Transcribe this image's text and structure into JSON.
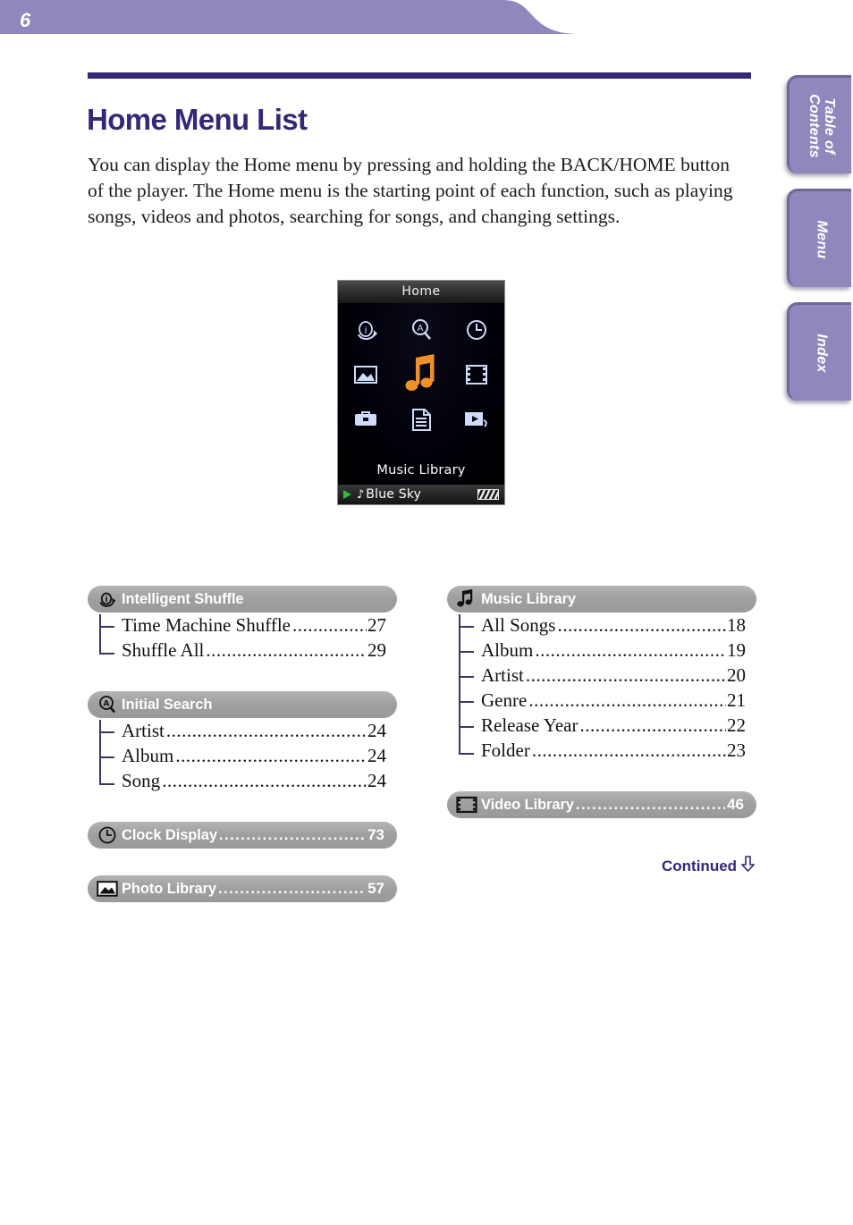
{
  "page": {
    "number": "6",
    "title": "Home Menu List",
    "intro": "You can display the Home menu by pressing and holding the BACK/HOME button of the player. The Home menu is the starting point of each function, such as playing songs, videos and photos, searching for songs, and changing settings.",
    "continued_label": "Continued",
    "continued_icon": "down-arrow-icon"
  },
  "side_tabs": [
    {
      "label": "Table of\nContents",
      "name": "table-of-contents"
    },
    {
      "label": "Menu",
      "name": "menu"
    },
    {
      "label": "Index",
      "name": "index"
    }
  ],
  "device": {
    "title": "Home",
    "caption": "Music Library",
    "status": {
      "play_icon": "play-icon",
      "note_icon": "music-note-icon",
      "track": "Blue Sky",
      "battery_icon": "battery-icon"
    },
    "icons": [
      "intelligent-shuffle-icon",
      "initial-search-icon",
      "clock-display-icon",
      "photo-library-icon",
      "music-library-icon",
      "video-library-icon",
      "settings-icon",
      "playlists-icon",
      "now-playing-icon"
    ]
  },
  "columns": {
    "left": [
      {
        "icon": "intelligent-shuffle-icon",
        "label": "Intelligent Shuffle",
        "page": "",
        "children": [
          {
            "label": "Time Machine Shuffle",
            "page": "27"
          },
          {
            "label": "Shuffle All",
            "page": "29"
          }
        ]
      },
      {
        "icon": "initial-search-icon",
        "label": "Initial Search",
        "page": "",
        "children": [
          {
            "label": "Artist",
            "page": "24"
          },
          {
            "label": "Album",
            "page": "24"
          },
          {
            "label": "Song",
            "page": "24"
          }
        ]
      },
      {
        "icon": "clock-display-icon",
        "label": "Clock Display",
        "page": "73",
        "children": []
      },
      {
        "icon": "photo-library-icon",
        "label": "Photo Library",
        "page": "57",
        "children": []
      }
    ],
    "right": [
      {
        "icon": "music-library-icon",
        "label": "Music Library",
        "page": "",
        "children": [
          {
            "label": "All Songs",
            "page": "18"
          },
          {
            "label": "Album",
            "page": "19"
          },
          {
            "label": "Artist",
            "page": "20"
          },
          {
            "label": "Genre",
            "page": "21"
          },
          {
            "label": "Release Year",
            "page": "22"
          },
          {
            "label": "Folder",
            "page": "23"
          }
        ]
      },
      {
        "icon": "video-library-icon",
        "label": "Video Library",
        "page": "46",
        "children": []
      }
    ]
  },
  "colors": {
    "header_band": "#9087bd",
    "title": "#332878",
    "pill": "#a0a0a0",
    "tab": "#9087bd",
    "accent_orange": "#f0902c",
    "device_icon_blue": "#b9ccf2"
  }
}
